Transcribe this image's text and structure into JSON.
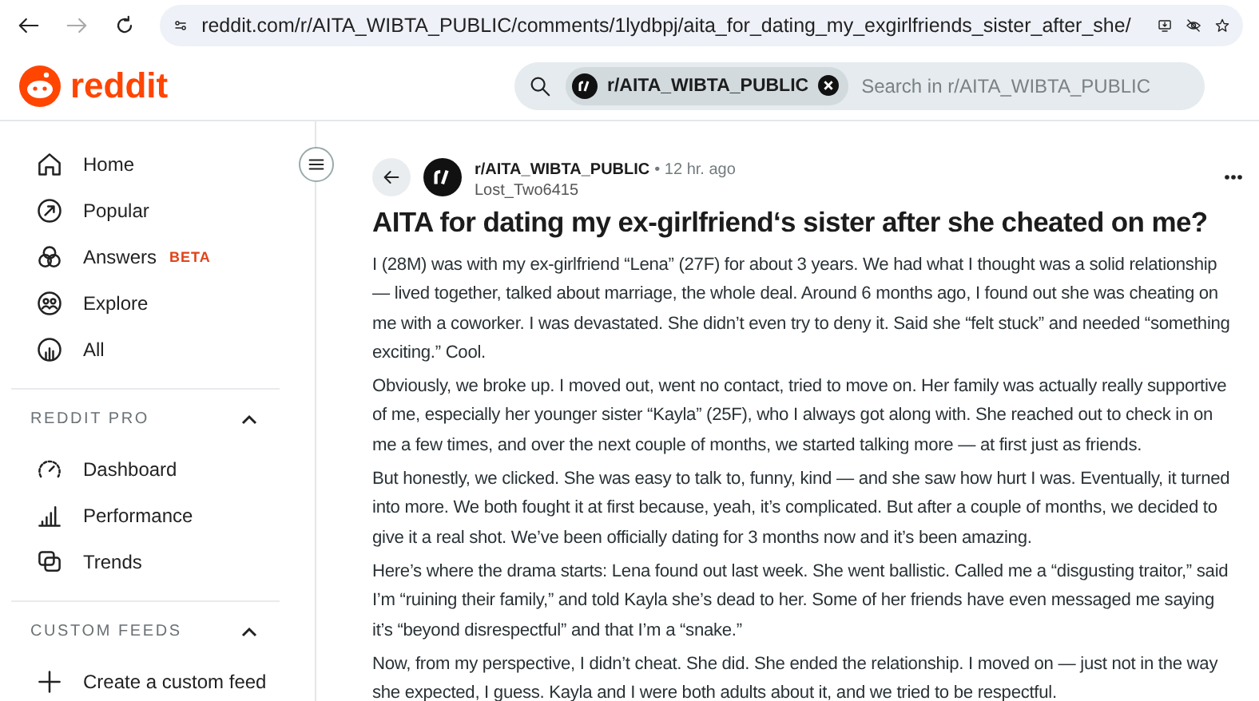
{
  "browser": {
    "url": "reddit.com/r/AITA_WIBTA_PUBLIC/comments/1lydbpj/aita_for_dating_my_exgirlfriends_sister_after_she/"
  },
  "header": {
    "logo": "reddit",
    "search": {
      "chip": "r/AITA_WIBTA_PUBLIC",
      "placeholder": "Search in r/AITA_WIBTA_PUBLIC"
    }
  },
  "sidebar": {
    "items": [
      {
        "label": "Home"
      },
      {
        "label": "Popular"
      },
      {
        "label": "Answers",
        "badge": "BETA"
      },
      {
        "label": "Explore"
      },
      {
        "label": "All"
      }
    ],
    "sections": [
      {
        "title": "REDDIT PRO",
        "expanded": true,
        "items": [
          {
            "label": "Dashboard"
          },
          {
            "label": "Performance"
          },
          {
            "label": "Trends"
          }
        ]
      },
      {
        "title": "CUSTOM FEEDS",
        "expanded": true,
        "items": [
          {
            "label": "Create a custom feed"
          }
        ]
      }
    ]
  },
  "post": {
    "subreddit": "r/AITA_WIBTA_PUBLIC",
    "time": "• 12 hr. ago",
    "author": "Lost_Two6415",
    "title": "AITA for dating my ex-girlfriend‘s sister after she cheated on me?",
    "paragraphs": [
      "I (28M) was with my ex-girlfriend “Lena” (27F) for about 3 years. We had what I thought was a solid relationship — lived together, talked about marriage, the whole deal. Around 6 months ago, I found out she was cheating on me with a coworker. I was devastated. She didn’t even try to deny it. Said she “felt stuck” and needed “something exciting.” Cool.",
      "Obviously, we broke up. I moved out, went no contact, tried to move on. Her family was actually really supportive of me, especially her younger sister “Kayla” (25F), who I always got along with. She reached out to check in on me a few times, and over the next couple of months, we started talking more — at first just as friends.",
      "But honestly, we clicked. She was easy to talk to, funny, kind — and she saw how hurt I was. Eventually, it turned into more. We both fought it at first because, yeah, it’s complicated. But after a couple of months, we decided to give it a real shot. We’ve been officially dating for 3 months now and it’s been amazing.",
      "Here’s where the drama starts: Lena found out last week. She went ballistic. Called me a “disgusting traitor,” said I’m “ruining their family,” and told Kayla she’s dead to her. Some of her friends have even messaged me saying it’s “beyond disrespectful” and that I’m a “snake.”",
      "Now, from my perspective, I didn’t cheat. She did. She ended the relationship. I moved on — just not in the way she expected, I guess. Kayla and I were both adults about it, and we tried to be respectful."
    ]
  }
}
